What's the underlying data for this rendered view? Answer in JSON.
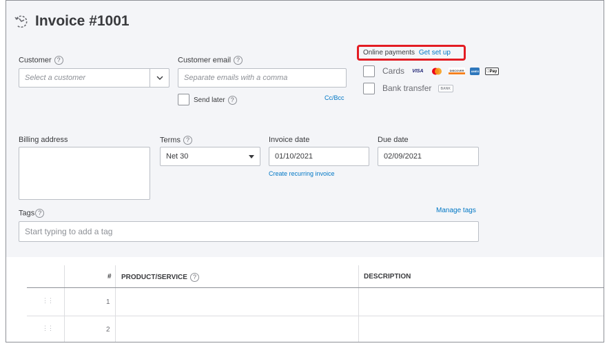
{
  "header": {
    "title": "Invoice #1001",
    "icon": "recurring-history-icon"
  },
  "customer": {
    "label": "Customer",
    "help": "?",
    "placeholder": "Select a customer"
  },
  "customer_email": {
    "label": "Customer email",
    "help": "?",
    "placeholder": "Separate emails with a comma",
    "send_later": "Send later",
    "cc_bcc": "Cc/Bcc"
  },
  "online_payments": {
    "label": "Online payments",
    "setup_link": "Get set up",
    "highlight_color": "#e31c23",
    "options": [
      {
        "label": "Cards",
        "badges": [
          "VISA",
          "MC",
          "DISCOVER",
          "AMEX",
          "Pay"
        ]
      },
      {
        "label": "Bank transfer",
        "badges": [
          "BANK"
        ]
      }
    ]
  },
  "billing_address": {
    "label": "Billing address",
    "value": ""
  },
  "terms": {
    "label": "Terms",
    "help": "?",
    "value": "Net 30"
  },
  "invoice_date": {
    "label": "Invoice date",
    "value": "01/10/2021",
    "recurring_link": "Create recurring invoice"
  },
  "due_date": {
    "label": "Due date",
    "value": "02/09/2021"
  },
  "tags": {
    "label": "Tags",
    "help": "?",
    "manage_link": "Manage tags",
    "placeholder": "Start typing to add a tag"
  },
  "table": {
    "columns": [
      "#",
      "PRODUCT/SERVICE",
      "DESCRIPTION"
    ],
    "product_help": "?",
    "rows": [
      {
        "num": "1"
      },
      {
        "num": "2"
      }
    ]
  },
  "colors": {
    "link": "#0077c5",
    "panel": "#f4f5f8"
  }
}
